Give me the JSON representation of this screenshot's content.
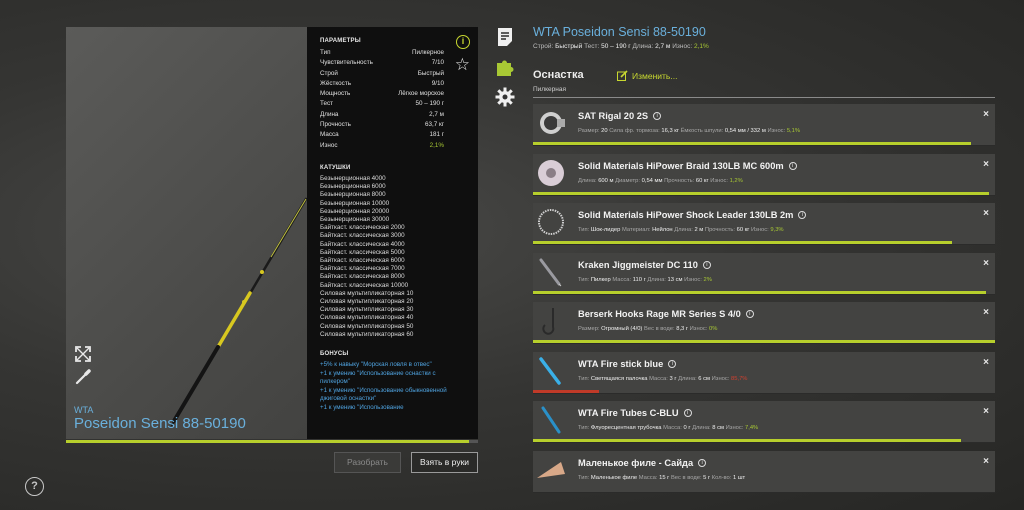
{
  "rod": {
    "brand": "WTA",
    "name": "Poseidon Sensi 88-50190"
  },
  "params": {
    "title": "ПАРАМЕТРЫ",
    "rows": [
      {
        "label": "Тип",
        "value": "Пилкерное"
      },
      {
        "label": "Чувствительность",
        "value": "7/10"
      },
      {
        "label": "Строй",
        "value": "Быстрый"
      },
      {
        "label": "Жёсткость",
        "value": "9/10"
      },
      {
        "label": "Мощность",
        "value": "Лёгкое морское"
      },
      {
        "label": "Тест",
        "value": "50 – 190 г"
      },
      {
        "label": "Длина",
        "value": "2,7 м"
      },
      {
        "label": "Прочность",
        "value": "63,7 кг"
      },
      {
        "label": "Масса",
        "value": "181 г"
      },
      {
        "label": "Износ",
        "value": "2,1%"
      }
    ],
    "reels_title": "КАТУШКИ",
    "reels": [
      "Безынерционная 4000",
      "Безынерционная 6000",
      "Безынерционная 8000",
      "Безынерционная 10000",
      "Безынерционная 20000",
      "Безынерционная 30000",
      "Байткаст. классическая 2000",
      "Байткаст. классическая 3000",
      "Байткаст. классическая 4000",
      "Байткаст. классическая 5000",
      "Байткаст. классическая 6000",
      "Байткаст. классическая 7000",
      "Байткаст. классическая 8000",
      "Байткаст. классическая 10000",
      "Силовая мультипликаторная 10",
      "Силовая мультипликаторная 20",
      "Силовая мультипликаторная 30",
      "Силовая мультипликаторная 40",
      "Силовая мультипликаторная 50",
      "Силовая мультипликаторная 60"
    ],
    "bonus_title": "БОНУСЫ",
    "bonuses": [
      "+5% к навыку \"Морская ловля в отвес\"",
      "+1 к умению \"Использование оснастки с пилкером\"",
      "+1 к умению \"Использование обыкновенной джиговой оснастки\"",
      "+1 к умению \"Использование"
    ]
  },
  "rod_condition": 0.979,
  "buttons": {
    "disassemble": "Разобрать",
    "take": "Взять в руки"
  },
  "right": {
    "title": "WTA Poseidon Sensi 88-50190",
    "sub_prefix": "Строй:",
    "sub_build": "Быстрый",
    "sub_test_label": "Тест:",
    "sub_test": "50 – 190 г",
    "sub_len_label": "Длина:",
    "sub_len": "2,7 м",
    "sub_wear_label": "Износ:",
    "sub_wear": "2,1%",
    "tackle_title": "Оснастка",
    "tackle_type": "Пилкерная",
    "edit_label": "Изменить..."
  },
  "items": [
    {
      "name": "SAT Rigal 20 2S",
      "stats": [
        [
          "Размер:",
          "20"
        ],
        [
          "Сила фр. тормоза:",
          "16,3 кг"
        ],
        [
          "Ёмкость шпули:",
          "0,54 мм / 332 м"
        ],
        [
          "Износ:",
          "5,1%"
        ]
      ],
      "condition": 0.949,
      "bar_red": false
    },
    {
      "name": "Solid Materials HiPower Braid 130LB MC 600m",
      "stats": [
        [
          "Длина:",
          "600 м"
        ],
        [
          "Диаметр:",
          "0,54 мм"
        ],
        [
          "Прочность:",
          "60 кг"
        ],
        [
          "Износ:",
          "1,2%"
        ]
      ],
      "condition": 0.988,
      "bar_red": false
    },
    {
      "name": "Solid Materials HiPower Shock Leader 130LB 2m",
      "stats": [
        [
          "Тип:",
          "Шок-лидер"
        ],
        [
          "Материал:",
          "Нейлон"
        ],
        [
          "Длина:",
          "2 м"
        ],
        [
          "Прочность:",
          "60 кг"
        ],
        [
          "Износ:",
          "9,3%"
        ]
      ],
      "condition": 0.907,
      "bar_red": false
    },
    {
      "name": "Kraken Jiggmeister DC 110",
      "stats": [
        [
          "Тип:",
          "Пилкер"
        ],
        [
          "Масса:",
          "110 г"
        ],
        [
          "Длина:",
          "13 см"
        ],
        [
          "Износ:",
          "2%"
        ]
      ],
      "condition": 0.98,
      "bar_red": false
    },
    {
      "name": "Berserk Hooks Rage MR Series S 4/0",
      "stats": [
        [
          "Размер:",
          "Огромный (4/0)"
        ],
        [
          "Вес в воде:",
          "8,3 г"
        ],
        [
          "Износ:",
          "0%"
        ]
      ],
      "condition": 1.0,
      "bar_red": false
    },
    {
      "name": "WTA Fire stick blue",
      "stats": [
        [
          "Тип:",
          "Светящаяся палочка"
        ],
        [
          "Масса:",
          "3 г"
        ],
        [
          "Длина:",
          "6 см"
        ],
        [
          "Износ:",
          "85,7%"
        ]
      ],
      "condition": 0.143,
      "bar_red": true
    },
    {
      "name": "WTA Fire Tubes C-BLU",
      "stats": [
        [
          "Тип:",
          "Флуоресцентная трубочка"
        ],
        [
          "Масса:",
          "0 г"
        ],
        [
          "Длина:",
          "8 см"
        ],
        [
          "Износ:",
          "7,4%"
        ]
      ],
      "condition": 0.926,
      "bar_red": false
    },
    {
      "name": "Маленькое филе - Сайда",
      "stats": [
        [
          "Тип:",
          "Маленькое филе"
        ],
        [
          "Масса:",
          "15 г"
        ],
        [
          "Вес в воде:",
          "5 г"
        ],
        [
          "Кол-во:",
          "1 шт"
        ]
      ],
      "condition": 1.0,
      "bar_red": false,
      "no_bar": true
    }
  ],
  "colors": {
    "accent_blue": "#6ab0dc",
    "accent_green": "#b7cf2c",
    "warning_red": "#c03a28"
  },
  "icons": {
    "info": "info-icon",
    "star": "star-icon",
    "help": "help-icon",
    "edit": "edit-icon",
    "expand": "expand-icon",
    "brush": "brush-icon",
    "notes": "document-icon",
    "tackle": "puzzle-icon",
    "settings": "gear-icon"
  }
}
